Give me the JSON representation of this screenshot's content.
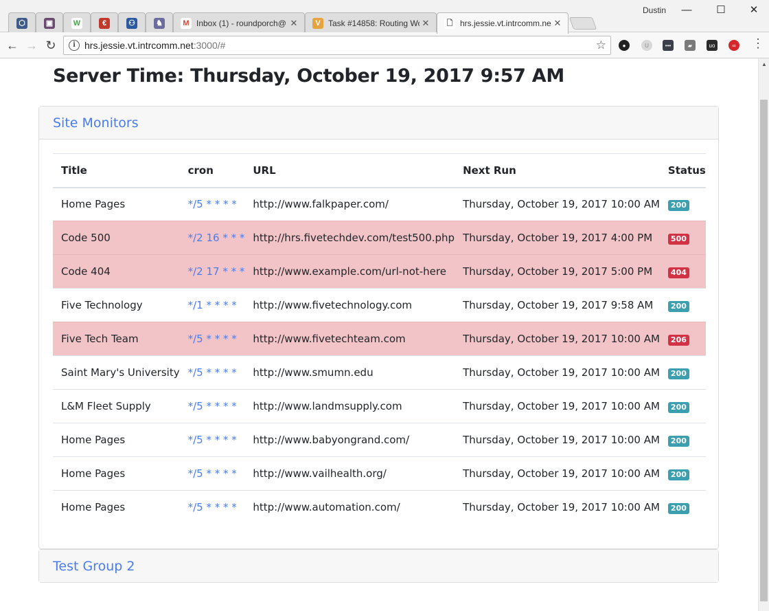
{
  "browser": {
    "tabs": [
      {
        "kind": "small",
        "icon": "hexagon-app-icon",
        "color": "#3e5a8a",
        "glyph": "⬡"
      },
      {
        "kind": "small",
        "icon": "floppy-app-icon",
        "color": "#6a4b6f",
        "glyph": "▣"
      },
      {
        "kind": "small",
        "icon": "w-app-icon",
        "color": "#ffffff",
        "glyph": "W",
        "glyph_color": "#47a447"
      },
      {
        "kind": "small",
        "icon": "e-app-icon",
        "color": "#c0392b",
        "glyph": "€"
      },
      {
        "kind": "small",
        "icon": "people-app-icon",
        "color": "#2c5aa0",
        "glyph": "⚇"
      },
      {
        "kind": "small",
        "icon": "rabbit-app-icon",
        "color": "#6b6b9e",
        "glyph": "♞"
      },
      {
        "kind": "full",
        "icon": "gmail-icon",
        "title": "Inbox (1) - roundporch@",
        "color": "#ffffff",
        "glyph": "M",
        "glyph_color": "#d44638"
      },
      {
        "kind": "full",
        "icon": "task-icon",
        "title": "Task #14858: Routing Wo",
        "color": "#e7a33e",
        "glyph": "V"
      },
      {
        "kind": "full",
        "icon": "page-icon",
        "title": "hrs.jessie.vt.intrcomm.ne",
        "color": "#ffffff",
        "glyph": "🗋",
        "glyph_color": "#555555",
        "active": true
      }
    ],
    "profile_name": "Dustin",
    "window_buttons": {
      "minimize": "—",
      "maximize": "☐",
      "close": "✕"
    },
    "url_host": "hrs.jessie.vt.intrcomm.net",
    "url_rest": ":3000/#"
  },
  "page": {
    "server_time_label": "Server Time:",
    "server_time_value": "Thursday, October 19, 2017 9:57 AM",
    "groups": [
      {
        "title": "Site Monitors"
      },
      {
        "title": "Test Group 2"
      }
    ],
    "table": {
      "headers": [
        "Title",
        "cron",
        "URL",
        "Next Run",
        "Status"
      ],
      "rows": [
        {
          "title": "Home Pages",
          "cron": "*/5 * * * *",
          "url": "http://www.falkpaper.com/",
          "next_run": "Thursday, October 19, 2017 10:00 AM",
          "status": "200",
          "error": false
        },
        {
          "title": "Code 500",
          "cron": "*/2 16 * * *",
          "url": "http://hrs.fivetechdev.com/test500.php",
          "next_run": "Thursday, October 19, 2017 4:00 PM",
          "status": "500",
          "error": true
        },
        {
          "title": "Code 404",
          "cron": "*/2 17 * * *",
          "url": "http://www.example.com/url-not-here",
          "next_run": "Thursday, October 19, 2017 5:00 PM",
          "status": "404",
          "error": true
        },
        {
          "title": "Five Technology",
          "cron": "*/1 * * * *",
          "url": "http://www.fivetechnology.com",
          "next_run": "Thursday, October 19, 2017 9:58 AM",
          "status": "200",
          "error": false
        },
        {
          "title": "Five Tech Team",
          "cron": "*/5 * * * *",
          "url": "http://www.fivetechteam.com",
          "next_run": "Thursday, October 19, 2017 10:00 AM",
          "status": "206",
          "error": true
        },
        {
          "title": "Saint Mary's University",
          "cron": "*/5 * * * *",
          "url": "http://www.smumn.edu",
          "next_run": "Thursday, October 19, 2017 10:00 AM",
          "status": "200",
          "error": false
        },
        {
          "title": "L&M Fleet Supply",
          "cron": "*/5 * * * *",
          "url": "http://www.landmsupply.com",
          "next_run": "Thursday, October 19, 2017 10:00 AM",
          "status": "200",
          "error": false
        },
        {
          "title": "Home Pages",
          "cron": "*/5 * * * *",
          "url": "http://www.babyongrand.com/",
          "next_run": "Thursday, October 19, 2017 10:00 AM",
          "status": "200",
          "error": false
        },
        {
          "title": "Home Pages",
          "cron": "*/5 * * * *",
          "url": "http://www.vailhealth.org/",
          "next_run": "Thursday, October 19, 2017 10:00 AM",
          "status": "200",
          "error": false
        },
        {
          "title": "Home Pages",
          "cron": "*/5 * * * *",
          "url": "http://www.automation.com/",
          "next_run": "Thursday, October 19, 2017 10:00 AM",
          "status": "200",
          "error": false
        }
      ]
    }
  },
  "colors": {
    "link_blue": "#4a7cf0",
    "error_row": "#f2c4c8",
    "badge_ok": "#3b9fb0",
    "badge_bad": "#d33245"
  }
}
